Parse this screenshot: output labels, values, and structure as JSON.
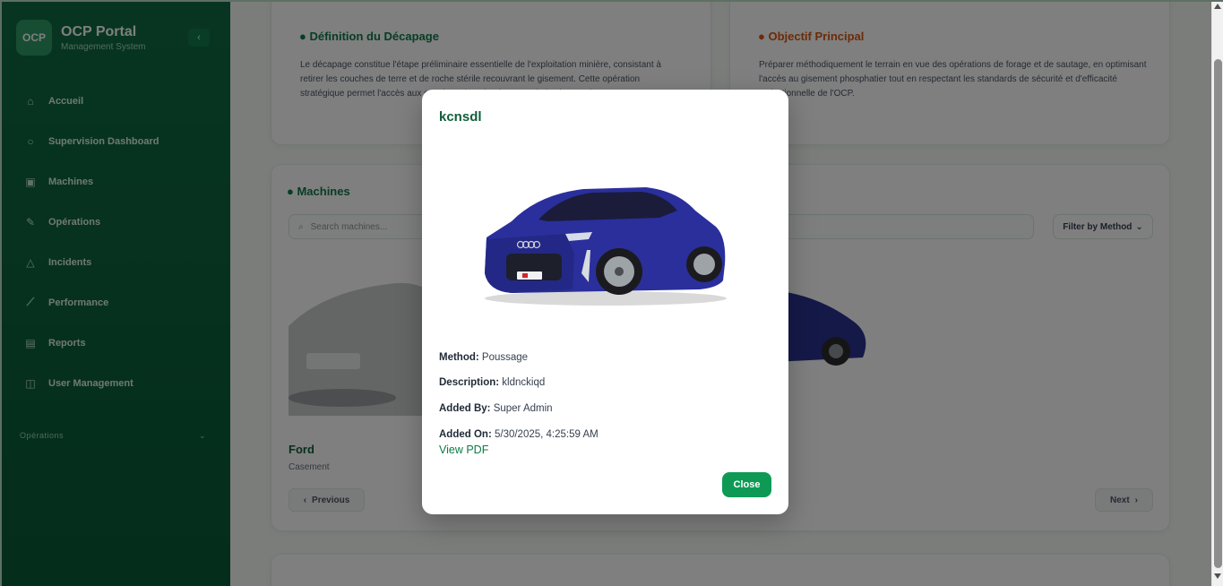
{
  "brand": {
    "logo_text": "OCP",
    "title": "OCP Portal",
    "subtitle": "Management System",
    "collapse_icon": "chevron-left-icon"
  },
  "sidebar": {
    "items": [
      {
        "label": "Accueil",
        "icon": "home-icon"
      },
      {
        "label": "Supervision Dashboard",
        "icon": "circle-icon"
      },
      {
        "label": "Machines",
        "icon": "machine-icon"
      },
      {
        "label": "Opérations",
        "icon": "wrench-icon"
      },
      {
        "label": "Incidents",
        "icon": "alert-icon"
      },
      {
        "label": "Performance",
        "icon": "chart-icon"
      },
      {
        "label": "Reports",
        "icon": "file-icon"
      },
      {
        "label": "User Management",
        "icon": "users-icon"
      }
    ],
    "section_label": "Opérations",
    "colors": {
      "background": "#0e6b43",
      "accent": "#2f9a67"
    }
  },
  "cards": {
    "definition": {
      "title": "Définition du Décapage",
      "body": "Le décapage constitue l'étape préliminaire essentielle de l'exploitation minière, consistant à retirer les couches de terre et de roche stérile recouvrant le gisement. Cette opération stratégique permet l'accès aux couches phosphatées et optimise l'extraction."
    },
    "objectif": {
      "title": "Objectif Principal",
      "body": "Préparer méthodiquement le terrain en vue des opérations de forage et de sautage, en optimisant l'accès au gisement phosphatier tout en respectant les standards de sécurité et d'efficacité opérationnelle de l'OCP."
    },
    "machines": {
      "title": "Machines",
      "search_placeholder": "Search machines...",
      "filter_label": "Filter by Method",
      "card_name": "Ford",
      "card_method": "Casement",
      "prev_label": "Previous",
      "next_label": "Next"
    }
  },
  "modal": {
    "title": "kcnsdl",
    "image_alt": "blue sedan car",
    "details": [
      {
        "label": "Method:",
        "value": "Poussage"
      },
      {
        "label": "Description:",
        "value": "kldnckiqd"
      },
      {
        "label": "Added By:",
        "value": "Super Admin"
      },
      {
        "label": "Added On:",
        "value": "5/30/2025, 4:25:59 AM"
      }
    ],
    "view_pdf": "View PDF",
    "close_label": "Close",
    "colors": {
      "title": "#0f5e3a",
      "button": "#0e9a55",
      "car_body": "#2a2f9c"
    }
  }
}
